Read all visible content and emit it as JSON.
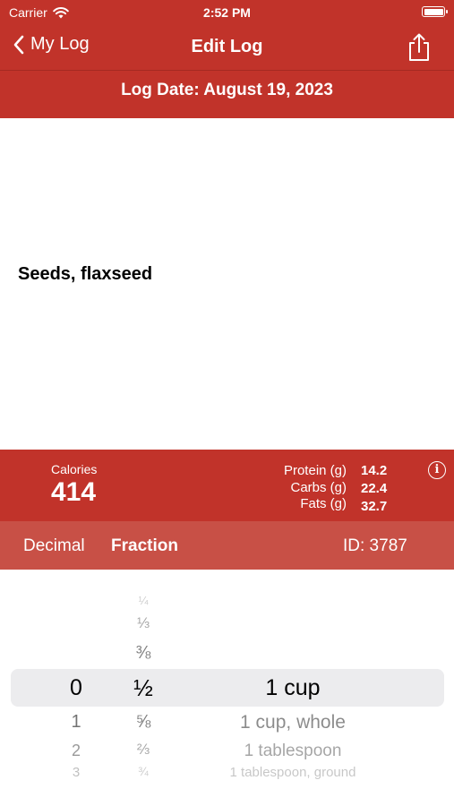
{
  "status": {
    "carrier": "Carrier",
    "time": "2:52 PM"
  },
  "nav": {
    "back_label": "My Log",
    "title": "Edit Log"
  },
  "log_date": "Log Date: August 19, 2023",
  "food": {
    "name": "Seeds, flaxseed"
  },
  "nutrition": {
    "calories_label": "Calories",
    "calories_value": "414",
    "protein_label": "Protein (g)",
    "protein_value": "14.2",
    "carbs_label": "Carbs (g)",
    "carbs_value": "22.4",
    "fats_label": "Fats (g)",
    "fats_value": "32.7"
  },
  "modes": {
    "decimal": "Decimal",
    "fraction": "Fraction",
    "selected": "Fraction"
  },
  "id_text": "ID: 3787",
  "picker": {
    "whole": {
      "selected": "0",
      "below": [
        "1",
        "2",
        "3"
      ]
    },
    "fraction": {
      "above": [
        "¼",
        "⅓",
        "⅜"
      ],
      "selected": "½",
      "below": [
        "⅝",
        "⅔",
        "¾"
      ]
    },
    "unit": {
      "selected": "1 cup",
      "below": [
        "1 cup, whole",
        "1 tablespoon",
        "1 tablespoon, ground"
      ]
    }
  },
  "colors": {
    "header": "#c1332a",
    "modebar": "#c85046",
    "picker_selection": "#ececee"
  }
}
